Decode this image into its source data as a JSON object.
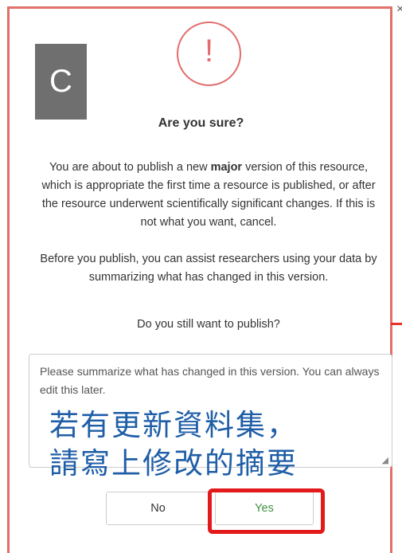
{
  "dialog": {
    "close_glyph": "×",
    "warning_glyph": "!",
    "title": "Are you sure?",
    "body_paragraph_1_pre": "You are about to publish a new ",
    "body_paragraph_1_bold": "major",
    "body_paragraph_1_post": " version of this resource, which is appropriate the first time a resource is published, or after the resource underwent scientifically significant changes. If this is not what you want, cancel.",
    "body_paragraph_2": "Before you publish, you can assist researchers using your data by summarizing what has changed in this version.",
    "question": "Do you still want to publish?",
    "summary_placeholder": "Please summarize what has changed in this version. You can always edit this later.",
    "no_label": "No",
    "yes_label": "Yes"
  },
  "annotations": {
    "step_badge": "C",
    "chinese_line_1": "若有更新資料集，",
    "chinese_line_2": "請寫上修改的摘要"
  },
  "colors": {
    "frame_border": "#e07068",
    "warning_red": "#e26d6d",
    "yes_green": "#3f9143",
    "highlight_red": "#e31a1a",
    "annotation_blue": "#1f5ea7",
    "badge_gray": "#6f6f6f"
  }
}
